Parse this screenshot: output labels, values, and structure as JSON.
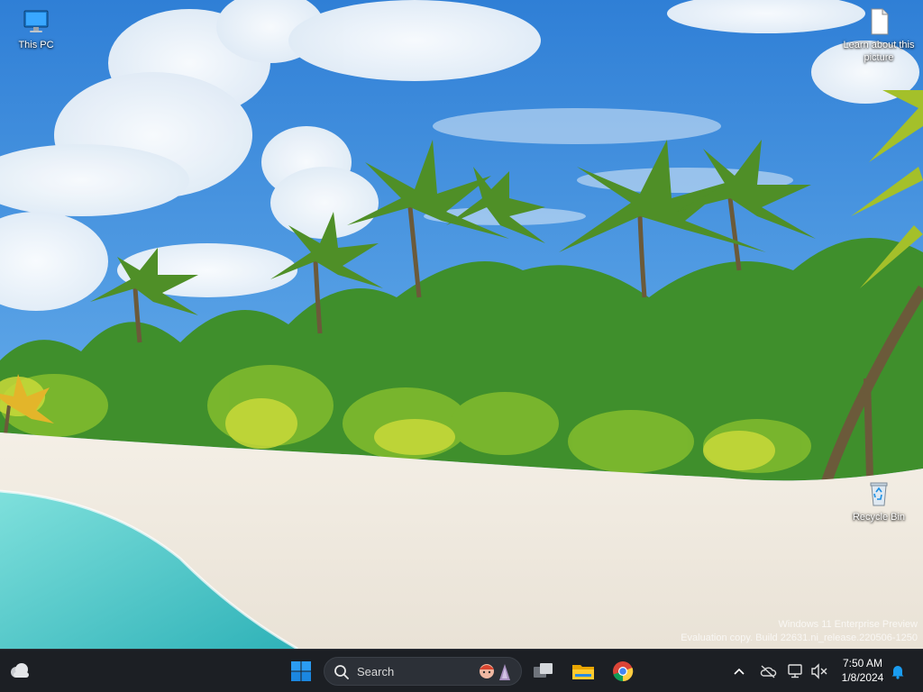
{
  "desktop": {
    "icons": [
      {
        "label": "This PC",
        "icon": "monitor-icon"
      },
      {
        "label": "Learn about this picture",
        "icon": "document-icon"
      },
      {
        "label": "Recycle Bin",
        "icon": "recycle-bin-icon"
      }
    ],
    "watermark": {
      "line1": "Windows 11 Enterprise Preview",
      "line2": "Evaluation copy. Build 22631.ni_release.220506-1250"
    }
  },
  "taskbar": {
    "widgets_icon": "weather-cloud-icon",
    "start_icon": "windows-start-icon",
    "search": {
      "placeholder": "Search"
    },
    "apps": [
      {
        "name": "Task View",
        "icon": "task-view-icon"
      },
      {
        "name": "File Explorer",
        "icon": "file-explorer-icon"
      },
      {
        "name": "Google Chrome",
        "icon": "chrome-icon"
      }
    ],
    "tray": {
      "icons": [
        "chevron-up-icon",
        "onedrive-offline-icon",
        "network-icon",
        "volume-muted-icon",
        "notification-bell-icon"
      ],
      "time": "7:50 AM",
      "date": "1/8/2024"
    }
  },
  "colors": {
    "taskbar_bg": "#1c1f24",
    "accent": "#1a9cf0"
  }
}
